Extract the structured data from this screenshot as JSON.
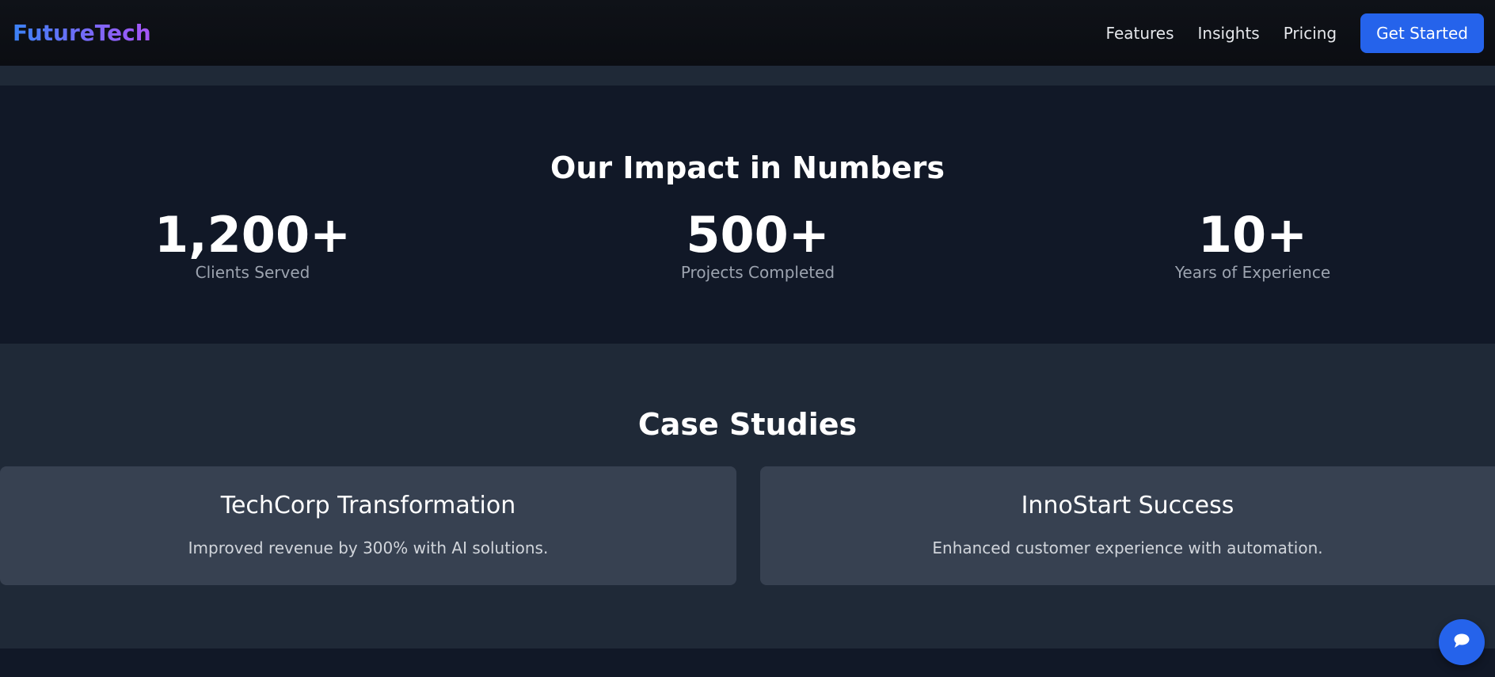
{
  "header": {
    "logo": "FutureTech",
    "nav": [
      "Features",
      "Insights",
      "Pricing"
    ],
    "cta_label": "Get Started"
  },
  "stats": {
    "title": "Our Impact in Numbers",
    "items": [
      {
        "value": "1,200+",
        "label": "Clients Served"
      },
      {
        "value": "500+",
        "label": "Projects Completed"
      },
      {
        "value": "10+",
        "label": "Years of Experience"
      }
    ]
  },
  "case_studies": {
    "title": "Case Studies",
    "items": [
      {
        "title": "TechCorp Transformation",
        "description": "Improved revenue by 300% with AI solutions."
      },
      {
        "title": "InnoStart Success",
        "description": "Enhanced customer experience with automation."
      }
    ]
  },
  "chat": {
    "icon": "chat-bubble-icon"
  },
  "colors": {
    "accent": "#2563eb",
    "logo_gradient_start": "#3b82f6",
    "logo_gradient_end": "#a855f7",
    "dark_bg": "#111827",
    "section_bg": "#1f2937",
    "card_bg": "#374151"
  }
}
